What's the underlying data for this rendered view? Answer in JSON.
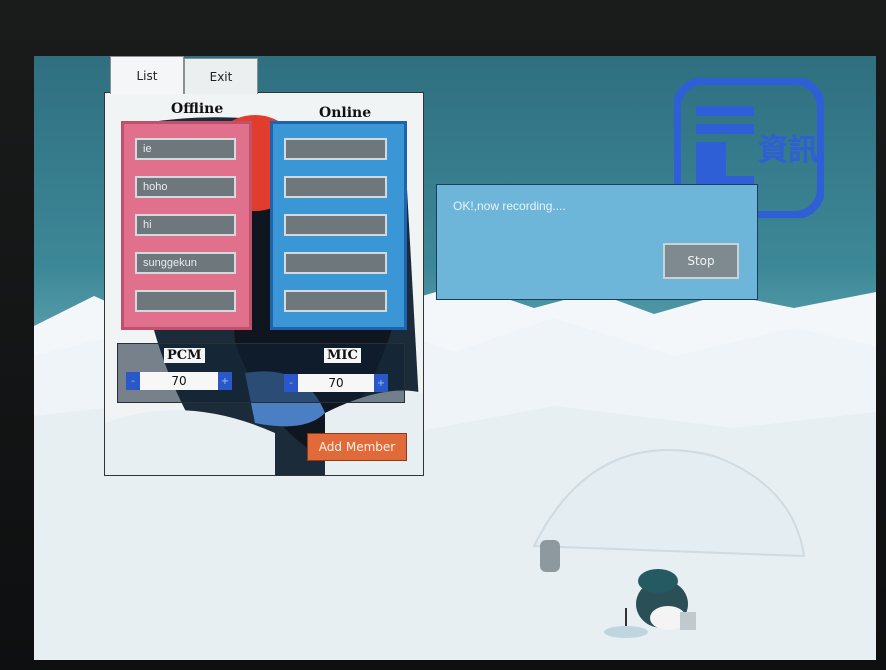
{
  "tabs": [
    {
      "label": "List"
    },
    {
      "label": "Exit"
    }
  ],
  "list_panel": {
    "offline_header": "Offline",
    "online_header": "Online",
    "offline_members": [
      "ie",
      "hoho",
      "hi",
      "sunggekun",
      ""
    ],
    "online_members": [
      "",
      "",
      "",
      "",
      ""
    ]
  },
  "controls": {
    "pcm": {
      "label": "PCM",
      "value": "70",
      "minus": "-",
      "plus": "+"
    },
    "mic": {
      "label": "MIC",
      "value": "70",
      "minus": "-",
      "plus": "+"
    },
    "add_member_label": "Add Member"
  },
  "recording_dialog": {
    "message": "OK!,now recording....",
    "stop_label": "Stop"
  },
  "watermark": {
    "text": "資訊"
  },
  "colors": {
    "offline_box": "#e0708b",
    "online_box": "#3a96d4",
    "add_button": "#e16a3a",
    "dialog": "#6eb5da",
    "stepper_button": "#2b58c9"
  }
}
